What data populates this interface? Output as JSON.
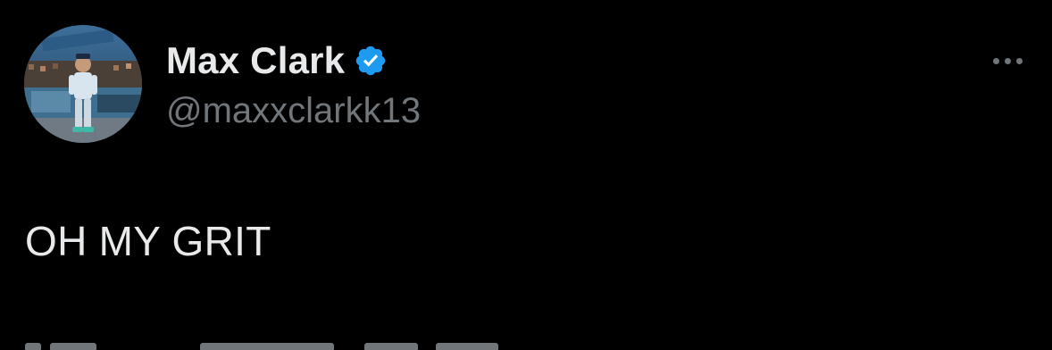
{
  "tweet": {
    "display_name": "Max Clark",
    "handle": "@maxxclarkk13",
    "text": "OH MY GRIT",
    "verified": true
  },
  "icons": {
    "verified": "verified-badge-icon",
    "more": "more-horizontal-icon"
  },
  "colors": {
    "background": "#000000",
    "name": "#e7e9ea",
    "handle": "#71767b",
    "verified": "#1d9bf0"
  }
}
